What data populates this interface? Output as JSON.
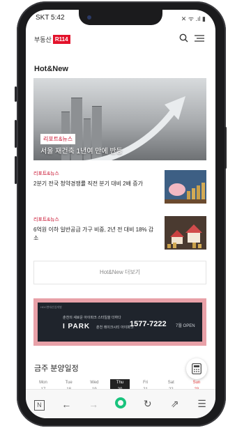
{
  "status_bar": {
    "carrier_time": "SKT 5:42",
    "indicators": "✕ ᯤ .ıl ▮"
  },
  "header": {
    "logo_text": "부동산",
    "logo_badge": "R114"
  },
  "main": {
    "section_title": "Hot&New",
    "hero": {
      "tag": "리포트&뉴스",
      "caption": "서울 재건축 1년여 만에 반등"
    },
    "news": [
      {
        "category": "리포트&뉴스",
        "title": "2분기 전국 청약경쟁률 직전 분기 대비 2배 증가"
      },
      {
        "category": "리포트&뉴스",
        "title": "6억원 이하 일반공급 가구 비중, 2년 전 대비 18% 감소"
      }
    ],
    "more_button": "Hot&New 더보기"
  },
  "ad": {
    "corner_text": "HDC현대산업개발",
    "small_text": "춘천의 새로운 아이파크 스타일을 더하다",
    "brand": "I PARK",
    "brand_sub": "춘천 레이크시티 아이파크",
    "phone": "1577-7222",
    "open_text": "7월 OPEN"
  },
  "schedule": {
    "title": "금주 분양일정",
    "days": [
      {
        "label": "Mon",
        "date": "17"
      },
      {
        "label": "Tue",
        "date": "18"
      },
      {
        "label": "Wed",
        "date": "19"
      },
      {
        "label": "Thu",
        "date": "20"
      },
      {
        "label": "Fri",
        "date": "21"
      },
      {
        "label": "Sat",
        "date": "22"
      },
      {
        "label": "Sun",
        "date": "23"
      }
    ]
  },
  "colors": {
    "brand_red": "#e3122b",
    "category_red": "#c8102e",
    "home_green": "#19c37d"
  },
  "icons": {
    "search": "search-icon",
    "menu": "hamburger-menu-icon",
    "calculator": "calculator-icon"
  }
}
